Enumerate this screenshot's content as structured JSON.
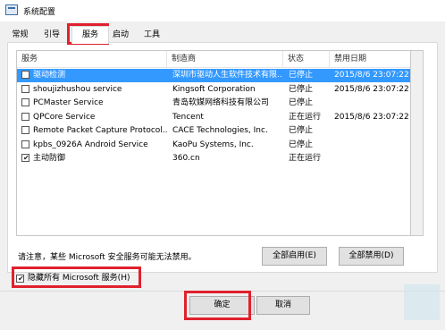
{
  "window": {
    "title": "系统配置"
  },
  "tabs": [
    {
      "label": "常规"
    },
    {
      "label": "引导"
    },
    {
      "label": "服务"
    },
    {
      "label": "启动"
    },
    {
      "label": "工具"
    }
  ],
  "columns": [
    "服务",
    "制造商",
    "状态",
    "禁用日期"
  ],
  "services": [
    {
      "name": "驱动检测",
      "vendor": "深圳市驱动人生软件技术有限...",
      "status": "已停止",
      "date": "2015/8/6 23:07:22",
      "checked": false,
      "selected": true
    },
    {
      "name": "shoujizhushou service",
      "vendor": "Kingsoft Corporation",
      "status": "已停止",
      "date": "2015/8/6 23:07:22",
      "checked": false,
      "selected": false
    },
    {
      "name": "PCMaster Service",
      "vendor": "青岛软媒网络科技有限公司",
      "status": "已停止",
      "date": "",
      "checked": false,
      "selected": false
    },
    {
      "name": "QPCore Service",
      "vendor": "Tencent",
      "status": "正在运行",
      "date": "2015/8/6 23:07:22",
      "checked": false,
      "selected": false
    },
    {
      "name": "Remote Packet Capture Protocol...",
      "vendor": "CACE Technologies, Inc.",
      "status": "已停止",
      "date": "",
      "checked": false,
      "selected": false
    },
    {
      "name": "kpbs_0926A Android Service",
      "vendor": "KaoPu Systems, Inc.",
      "status": "已停止",
      "date": "",
      "checked": false,
      "selected": false
    },
    {
      "name": "主动防御",
      "vendor": "360.cn",
      "status": "正在运行",
      "date": "",
      "checked": true,
      "selected": false
    }
  ],
  "note": "请注意，某些 Microsoft 安全服务可能无法禁用。",
  "buttons": {
    "enable_all": "全部启用(E)",
    "disable_all": "全部禁用(D)",
    "ok": "确定",
    "cancel": "取消"
  },
  "hide_ms": {
    "label": "隐藏所有 Microsoft 服务(H)",
    "checked": true
  },
  "colors": {
    "highlight": "#e0212d",
    "selection": "#3399ff"
  }
}
